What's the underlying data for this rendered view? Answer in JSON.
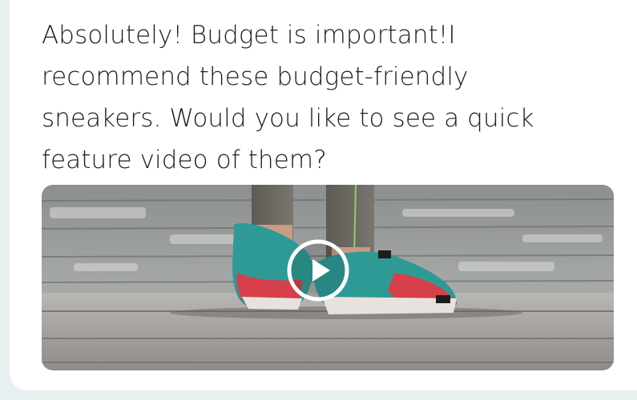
{
  "chat": {
    "message_text": "Absolutely! Budget is important!I recommend these budget-friendly sneakers. Would you like to see a quick feature video of them?"
  },
  "video": {
    "thumbnail_subject": "teal and red running sneakers on wooden boardwalk",
    "play_icon": "play-icon"
  },
  "colors": {
    "background": "#e6f0f1",
    "bubble": "#ffffff",
    "text": "#1d1d1d",
    "shoe_teal": "#2e9a96",
    "shoe_red": "#d6404a"
  }
}
